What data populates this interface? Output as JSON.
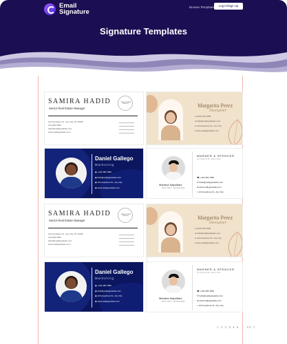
{
  "brand": {
    "line1": "Email",
    "line2": "Signature"
  },
  "nav": {
    "browse": "Browse Templates",
    "login": "Log in/Sign Up"
  },
  "page_title": "Signature Templates",
  "cards": {
    "samira": {
      "name": "SAMIRA HADID",
      "title": "Senior Real Estate Manager",
      "stamp": "REAL ESTATE AGENCY",
      "address": "123 Anywhere St., Any City, ST 12345",
      "phone": "123-456-7890",
      "email": "hello@reallygreatsite.com",
      "web": "www.reallygreatsite.com"
    },
    "margarita": {
      "name": "Margarita Perez",
      "title": "Designer",
      "phone": "(123) 456-7890",
      "email": "hello@reallygreatsite.com",
      "address": "123 Anywhere St., Any City",
      "web": "www.reallygreatsite.com"
    },
    "daniel": {
      "name": "Daniel Gallego",
      "title": "Marketing",
      "phone": "+123-456-7890",
      "email": "hello@reallygreatsite.com",
      "address": "123 Anywhere St., Any City",
      "web": "www.reallygreatsite.com"
    },
    "mariana": {
      "name": "Mariana Napolitani",
      "title": "PROJECT MANAGER",
      "company": "WARNER & SPENCER",
      "company_sub": "INTERIOR DESIGN",
      "phone": "+123-456-7890",
      "email": "hello@reallygreatsite.com",
      "web": "www.reallygreatsite.com",
      "address": "123 Anywhere St., Any City"
    }
  },
  "pager": "< 1 2 3 4 5 ... 10 >",
  "colors": {
    "header": "#1c0e52",
    "beige": "#f1e2cc",
    "navy": "#0d1a6e",
    "accent": "#c9a46a"
  }
}
